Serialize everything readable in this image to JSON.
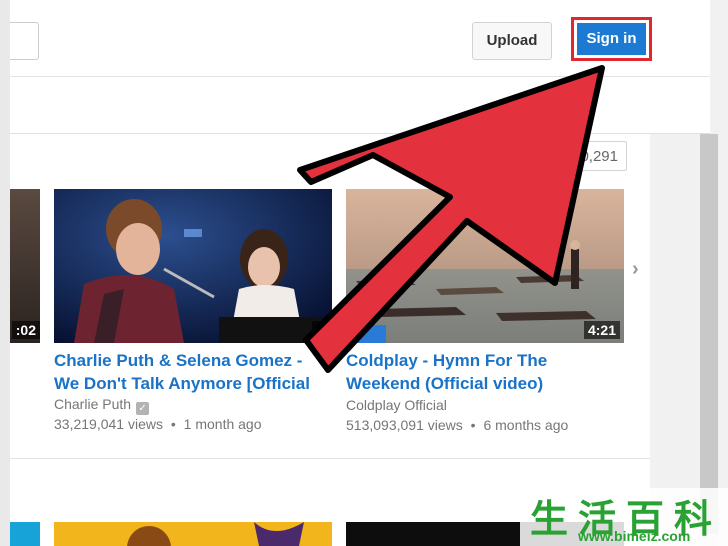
{
  "header": {
    "upload_label": "Upload",
    "signin_label": "Sign in"
  },
  "shelf": {
    "view_count_badge": "370,291"
  },
  "videos": [
    {
      "duration": ":02"
    },
    {
      "title_line1": "Charlie Puth & Selena Gomez -",
      "title_line2": "We Don't Talk Anymore [Official",
      "channel": "Charlie Puth",
      "views": "33,219,041 views",
      "age": "1 month ago",
      "duration": "3"
    },
    {
      "title_line1": "Coldplay - Hymn For The",
      "title_line2": "Weekend (Official video)",
      "channel": "Coldplay Official",
      "views": "513,093,091 views",
      "age": "6 months ago",
      "duration": "4:21"
    }
  ],
  "meta_separator": "•",
  "watermark": {
    "text": "生活百科",
    "url": "www.bimeiz.com"
  },
  "colors": {
    "signin_blue": "#1c7ad3",
    "highlight_red": "#e0262f",
    "link_blue": "#1a73c7"
  }
}
